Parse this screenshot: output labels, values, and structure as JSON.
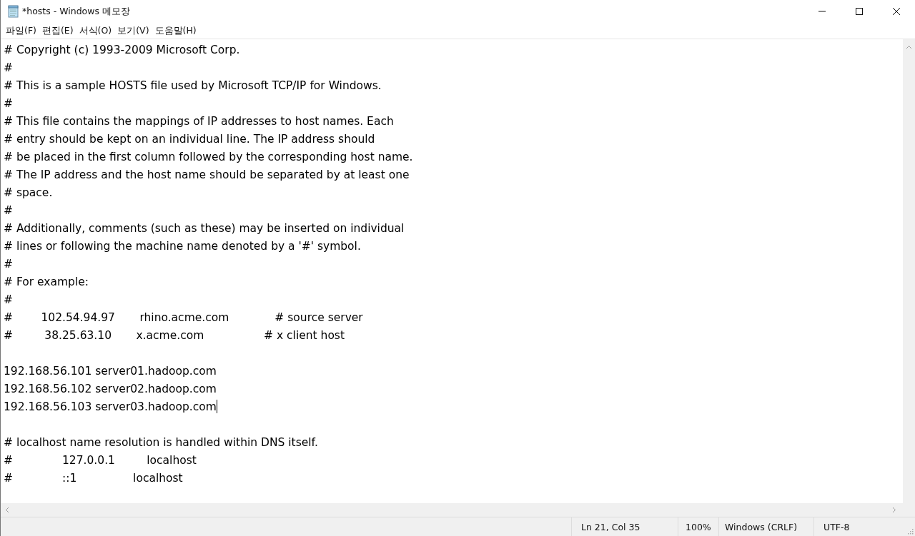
{
  "window": {
    "title": "*hosts - Windows 메모장"
  },
  "menu": [
    "파일(F)",
    "편집(E)",
    "서식(O)",
    "보기(V)",
    "도움말(H)"
  ],
  "editor": {
    "paragraphs": [
      [
        {
          "text": "# Copyright (c) 1993-2009 Microsoft Corp.",
          "caret": false
        },
        {
          "text": "#",
          "caret": false
        },
        {
          "text": "# This is a sample HOSTS file used by Microsoft TCP/IP for Windows.",
          "caret": false
        },
        {
          "text": "#",
          "caret": false
        },
        {
          "text": "# This file contains the mappings of IP addresses to host names. Each",
          "caret": false
        },
        {
          "text": "# entry should be kept on an individual line. The IP address should",
          "caret": false
        },
        {
          "text": "# be placed in the first column followed by the corresponding host name.",
          "caret": false
        },
        {
          "text": "# The IP address and the host name should be separated by at least one",
          "caret": false
        },
        {
          "text": "# space.",
          "caret": false
        },
        {
          "text": "#",
          "caret": false
        },
        {
          "text": "# Additionally, comments (such as these) may be inserted on individual",
          "caret": false
        },
        {
          "text": "# lines or following the machine name denoted by a '#' symbol.",
          "caret": false
        },
        {
          "text": "#",
          "caret": false
        },
        {
          "text": "# For example:",
          "caret": false
        },
        {
          "text": "#",
          "caret": false
        },
        {
          "text": "#        102.54.94.97       rhino.acme.com             # source server",
          "caret": false
        },
        {
          "text": "#         38.25.63.10       x.acme.com                 # x client host",
          "caret": false
        }
      ],
      [
        {
          "text": "192.168.56.101 server01.hadoop.com",
          "caret": false
        },
        {
          "text": "192.168.56.102 server02.hadoop.com",
          "caret": false
        },
        {
          "text": "192.168.56.103 server03.hadoop.com",
          "caret": true
        }
      ],
      [
        {
          "text": "# localhost name resolution is handled within DNS itself.",
          "caret": false
        },
        {
          "text": "#              127.0.0.1         localhost",
          "caret": false
        },
        {
          "text": "#              ::1                localhost",
          "caret": false
        }
      ]
    ]
  },
  "status_bar": [
    "Ln 21, Col 35",
    "100%",
    "Windows (CRLF)",
    "UTF-8"
  ]
}
